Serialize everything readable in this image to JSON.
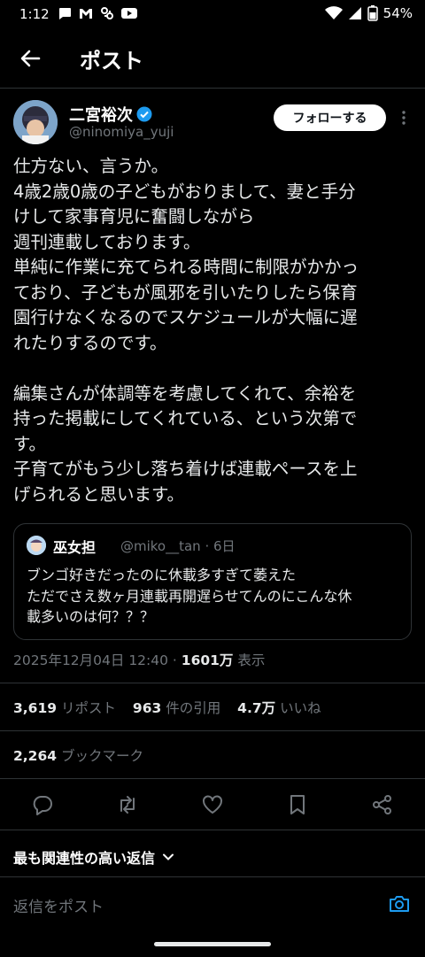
{
  "status": {
    "time": "1:12",
    "battery": "54%"
  },
  "header": {
    "title": "ポスト"
  },
  "author": {
    "name": "二宮裕次",
    "handle": "@ninomiya_yuji",
    "follow_label": "フォローする"
  },
  "post": {
    "text": "仕方ない、言うか。\n4歳2歳0歳の子どもがおりまして、妻と手分\nけして家事育児に奮闘しながら\n週刊連載しております。\n単純に作業に充てられる時間に制限がかかっ\nており、子どもが風邪を引いたりしたら保育\n園行けなくなるのでスケジュールが大幅に遅\nれたりするのです。\n\n編集さんが体調等を考慮してくれて、余裕を\n持った掲載にしてくれている、という次第で\nす。\n子育てがもう少し落ち着けば連載ペースを上\nげられると思います。"
  },
  "quote": {
    "name": "巫女担",
    "handle": "@miko__tan · 6日",
    "text": "ブンゴ好きだったのに休載多すぎて萎えた\nただでさえ数ヶ月連載再開遅らせてんのにこんな休\n載多いのは何？？？"
  },
  "meta": {
    "datetime": "2025年12月04日 12:40 · ",
    "views": "1601万",
    "views_label": " 表示"
  },
  "stats": {
    "reposts": "3,619",
    "reposts_label": "リポスト",
    "quotes": "963",
    "quotes_label": "件の引用",
    "likes": "4.7万",
    "likes_label": "いいね",
    "bookmarks": "2,264",
    "bookmarks_label": "ブックマーク"
  },
  "replies": {
    "sort_label": "最も関連性の高い返信",
    "placeholder": "返信をポスト"
  },
  "colors": {
    "background": "#000000",
    "verified": "#1d9bf0",
    "accent": "#1d9bf0"
  }
}
